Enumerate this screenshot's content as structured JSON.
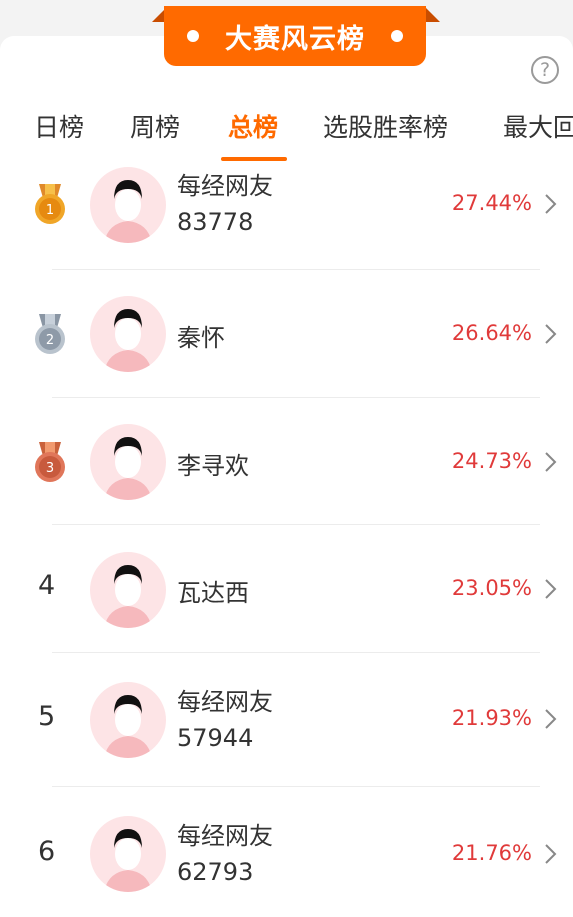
{
  "banner": {
    "title": "大赛风云榜"
  },
  "help_icon": "?",
  "tabs": [
    {
      "label": "日榜"
    },
    {
      "label": "周榜"
    },
    {
      "label": "总榜"
    },
    {
      "label": "选股胜率榜"
    },
    {
      "label": "最大回"
    }
  ],
  "active_tab": "总榜",
  "colors": {
    "accent": "#ff6a00",
    "rate": "#e03a3a"
  },
  "rows": [
    {
      "rank": "1",
      "medal": "gold-medal-icon",
      "name_line1": "每经网友",
      "name_line2": "83778",
      "rate": "27.44%"
    },
    {
      "rank": "2",
      "medal": "silver-medal-icon",
      "name_line1": "秦怀",
      "name_line2": "",
      "rate": "26.64%"
    },
    {
      "rank": "3",
      "medal": "bronze-medal-icon",
      "name_line1": "李寻欢",
      "name_line2": "",
      "rate": "24.73%"
    },
    {
      "rank": "4",
      "medal": "",
      "name_line1": "瓦达西",
      "name_line2": "",
      "rate": "23.05%"
    },
    {
      "rank": "5",
      "medal": "",
      "name_line1": "每经网友",
      "name_line2": "57944",
      "rate": "21.93%"
    },
    {
      "rank": "6",
      "medal": "",
      "name_line1": "每经网友",
      "name_line2": "62793",
      "rate": "21.76%"
    }
  ]
}
